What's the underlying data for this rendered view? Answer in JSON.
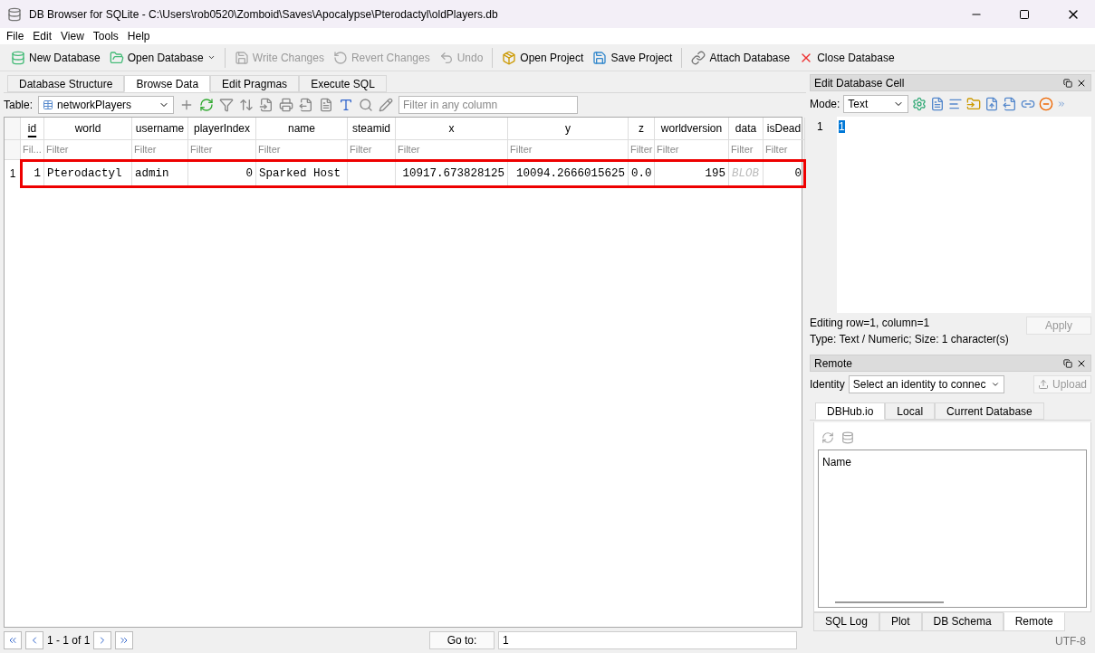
{
  "window": {
    "title": "DB Browser for SQLite - C:\\Users\\rob0520\\Zomboid\\Saves\\Apocalypse\\Pterodactyl\\oldPlayers.db"
  },
  "menu": [
    "File",
    "Edit",
    "View",
    "Tools",
    "Help"
  ],
  "toolbar": [
    {
      "label": "New Database",
      "disabled": false,
      "dropdown": false
    },
    {
      "label": "Open Database",
      "disabled": false,
      "dropdown": true
    },
    {
      "label": "Write Changes",
      "disabled": true,
      "dropdown": false
    },
    {
      "label": "Revert Changes",
      "disabled": true,
      "dropdown": false
    },
    {
      "label": "Undo",
      "disabled": true,
      "dropdown": false
    },
    {
      "label": "Open Project",
      "disabled": false,
      "dropdown": false
    },
    {
      "label": "Save Project",
      "disabled": false,
      "dropdown": false
    },
    {
      "label": "Attach Database",
      "disabled": false,
      "dropdown": false
    },
    {
      "label": "Close Database",
      "disabled": false,
      "dropdown": false
    }
  ],
  "tabs": [
    {
      "label": "Database Structure",
      "selected": false
    },
    {
      "label": "Browse Data",
      "selected": true
    },
    {
      "label": "Edit Pragmas",
      "selected": false
    },
    {
      "label": "Execute SQL",
      "selected": false
    }
  ],
  "browse": {
    "table_label": "Table:",
    "table_value": "networkPlayers",
    "filter_placeholder": "Filter in any column"
  },
  "columns": [
    {
      "label": "id",
      "primary_key": true,
      "filter": "Fil..."
    },
    {
      "label": "world",
      "primary_key": false,
      "filter": "Filter"
    },
    {
      "label": "username",
      "primary_key": false,
      "filter": "Filter"
    },
    {
      "label": "playerIndex",
      "primary_key": false,
      "filter": "Filter"
    },
    {
      "label": "name",
      "primary_key": false,
      "filter": "Filter"
    },
    {
      "label": "steamid",
      "primary_key": false,
      "filter": "Filter"
    },
    {
      "label": "x",
      "primary_key": false,
      "filter": "Filter"
    },
    {
      "label": "y",
      "primary_key": false,
      "filter": "Filter"
    },
    {
      "label": "z",
      "primary_key": false,
      "filter": "Filter"
    },
    {
      "label": "worldversion",
      "primary_key": false,
      "filter": "Filter"
    },
    {
      "label": "data",
      "primary_key": false,
      "filter": "Filter"
    },
    {
      "label": "isDead",
      "primary_key": false,
      "filter": "Filter"
    }
  ],
  "rows": [
    {
      "number": "1",
      "highlighted": true,
      "cells": [
        {
          "value": "1",
          "kind": "number"
        },
        {
          "value": "Pterodactyl",
          "kind": "text"
        },
        {
          "value": "admin",
          "kind": "text"
        },
        {
          "value": "0",
          "kind": "number"
        },
        {
          "value": "Sparked Host",
          "kind": "text"
        },
        {
          "kind": "text"
        },
        {
          "value": "10917.673828125",
          "kind": "number"
        },
        {
          "value": "10094.2666015625",
          "kind": "number"
        },
        {
          "value": "0.0",
          "kind": "text"
        },
        {
          "value": "195",
          "kind": "number"
        },
        {
          "value": "BLOB",
          "kind": "blob"
        },
        {
          "value": "0",
          "kind": "number"
        }
      ]
    }
  ],
  "pager": {
    "range": "1 - 1 of 1",
    "goto_label": "Go to:",
    "goto_value": "1"
  },
  "edit_cell": {
    "title": "Edit Database Cell",
    "mode_label": "Mode:",
    "mode_value": "Text",
    "line_number": "1",
    "content": "1",
    "status": "Editing row=1, column=1",
    "type_info": "Type: Text / Numeric; Size: 1 character(s)",
    "apply": {
      "label": "Apply",
      "disabled": true
    }
  },
  "remote": {
    "title": "Remote",
    "identity_label": "Identity",
    "identity_value": "Select an identity to connec",
    "upload": {
      "label": "Upload",
      "disabled": true
    },
    "tabs": [
      {
        "label": "DBHub.io",
        "selected": true
      },
      {
        "label": "Local",
        "selected": false
      },
      {
        "label": "Current Database",
        "selected": false
      }
    ],
    "list_header": "Name"
  },
  "bottom_tabs": [
    {
      "label": "SQL Log",
      "selected": false
    },
    {
      "label": "Plot",
      "selected": false
    },
    {
      "label": "DB Schema",
      "selected": false
    },
    {
      "label": "Remote",
      "selected": true
    }
  ],
  "status_bar": {
    "encoding": "UTF-8"
  }
}
